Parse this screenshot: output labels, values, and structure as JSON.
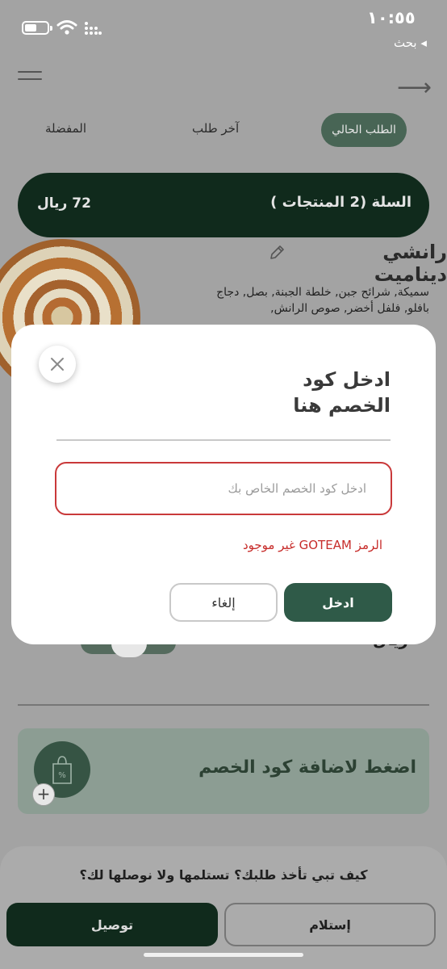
{
  "status_bar": {
    "time": "١٠:٥٥",
    "back_app": "◂ بحث"
  },
  "tabs": [
    {
      "label": "الطلب الحالي",
      "active": true
    },
    {
      "label": "آخر طلب",
      "active": false
    },
    {
      "label": "المفضلة",
      "active": false
    }
  ],
  "cart": {
    "title": "السلة (2 المنتجات )",
    "total": "72 ريال"
  },
  "product": {
    "name": "رانشي ديناميت",
    "description": "سميكة, شرائح جبن, خلطة الجبنة, بصل, دجاج بافلو, فلفل أخضر, صوص الرانش,",
    "price_partial": "ريال"
  },
  "discount_card": {
    "label": "اضغط لاضافة كود الخصم"
  },
  "bottom_sheet": {
    "question": "كيف تبي تأخذ طلبك؟ تستلمها ولا نوصلها لك؟",
    "delivery_label": "توصيل",
    "pickup_label": "إستلام"
  },
  "modal": {
    "title_line1": "ادخل كود",
    "title_line2": "الخصم هنا",
    "input_placeholder": "ادخل كود الخصم الخاص بك",
    "input_value": "",
    "error": "الرمز GOTEAM غير موجود",
    "enter_label": "ادخل",
    "cancel_label": "إلغاء"
  },
  "colors": {
    "brand_dark": "#102a1c",
    "brand_green": "#2f5a48",
    "error_red": "#c9393a"
  }
}
